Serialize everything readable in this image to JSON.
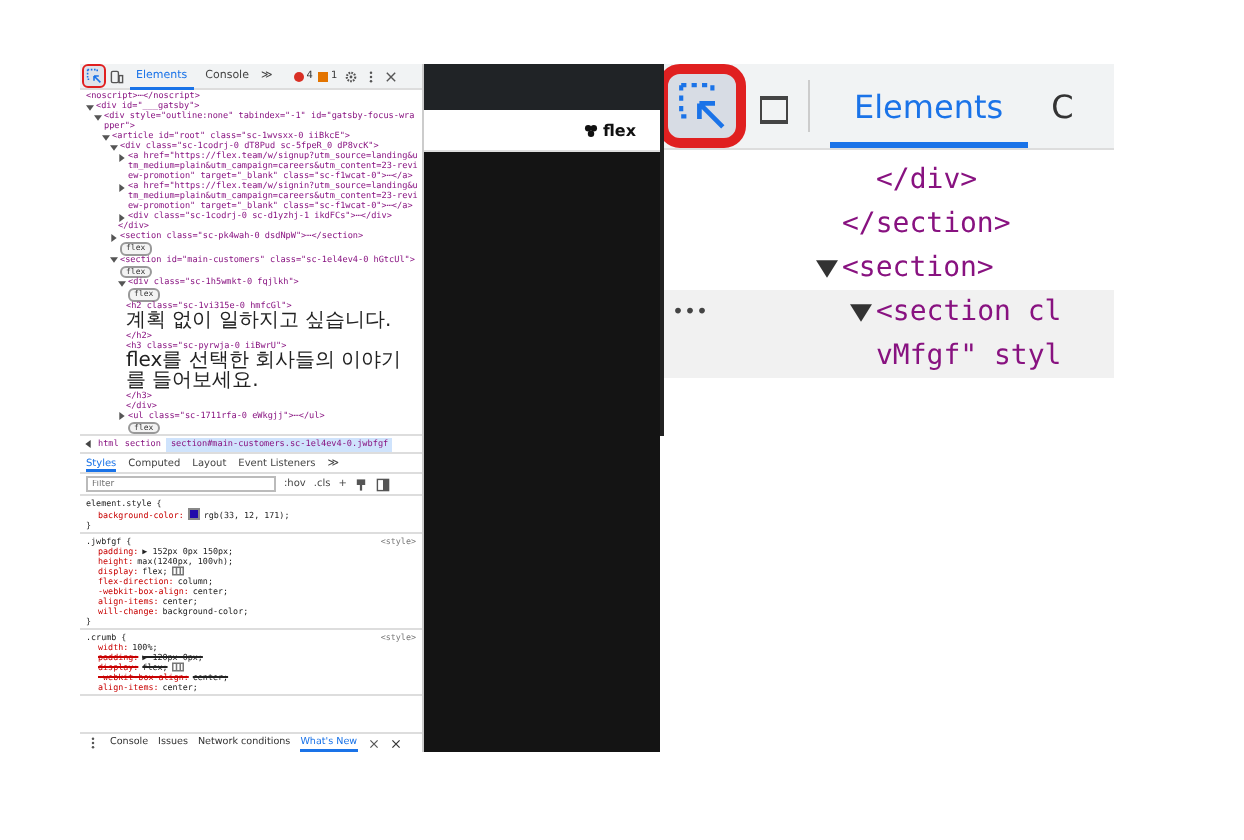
{
  "devtools": {
    "toolbar": {
      "tabs": [
        {
          "label": "Elements",
          "selected": true
        },
        {
          "label": "Console",
          "selected": false
        }
      ],
      "more": "≫",
      "error_count": "4",
      "warning_count": "1"
    },
    "dom_tree": [
      {
        "text": "<noscript>⋯</noscript>"
      },
      {
        "text": "<div id=\"___gatsby\">",
        "expanded": true,
        "children": [
          {
            "text": "<div style=\"outline:none\" tabindex=\"-1\" id=\"gatsby-focus-wrapper\">",
            "expanded": true,
            "children": [
              {
                "text": "<article id=\"root\" class=\"sc-1wvsxx-0 iiBkcE\">",
                "expanded": true,
                "children": [
                  {
                    "text": "<div class=\"sc-1codrj-0 dT8Pud sc-5fpeR_0 dP8vcK\">",
                    "expanded": true,
                    "children": [
                      {
                        "text": "<a href=\"https://flex.team/w/signup?utm_source=landing&utm_medium=plain&utm_campaign=careers&utm_content=23-review-promotion\" target=\"_blank\" class=\"sc-f1wcat-0\">⋯</a>",
                        "expanded": false
                      },
                      {
                        "text": "<a href=\"https://flex.team/w/signin?utm_source=landing&utm_medium=plain&utm_campaign=careers&utm_content=23-review-promotion\" target=\"_blank\" class=\"sc-f1wcat-0\">⋯</a>",
                        "expanded": false
                      },
                      {
                        "text": "<div class=\"sc-1codrj-0 sc-d1yzhj-1 ikdFCs\">⋯</div>",
                        "expanded": false
                      },
                      {
                        "text": "</div>"
                      }
                    ]
                  },
                  {
                    "text": "<section class=\"sc-pk4wah-0 dsdNpW\">⋯</section>",
                    "expanded": false,
                    "badge": "flex"
                  },
                  {
                    "text": "<section id=\"main-customers\" class=\"sc-1el4ev4-0 hGtcUl\">",
                    "expanded": true,
                    "badge": "flex",
                    "children": [
                      {
                        "text": "<div class=\"sc-1h5wmkt-0 fqjlkh\">",
                        "expanded": true,
                        "badge": "flex",
                        "children": [
                          {
                            "text": "<h2 class=\"sc-1vi315e-0 hmfcGl\">",
                            "korean": "계획 없이 일하지고 싶습니다.",
                            "tail": "</h2>"
                          },
                          {
                            "text": "<h3 class=\"sc-pyrwja-0 iiBwrU\">",
                            "korean": "flex를 선택한 회사들의 이야기를 들어보세요.",
                            "tail": "</h3>"
                          },
                          {
                            "text": "</div>"
                          }
                        ]
                      },
                      {
                        "text": "<ul class=\"sc-1711rfa-0 eWkgjj\">⋯</ul>",
                        "expanded": false,
                        "badge": "flex"
                      }
                    ]
                  }
                ]
              }
            ]
          }
        ]
      }
    ],
    "breadcrumbs": [
      {
        "label": "html",
        "selected": false
      },
      {
        "label": "section",
        "selected": false
      },
      {
        "label": "section#main-customers.sc-1el4ev4-0.jwbfgf",
        "selected": true
      }
    ],
    "style_tabs": [
      {
        "label": "Styles",
        "selected": true
      },
      {
        "label": "Computed",
        "selected": false
      },
      {
        "label": "Layout",
        "selected": false
      },
      {
        "label": "Event Listeners",
        "selected": false
      }
    ],
    "style_tabs_more": "≫",
    "filter": {
      "placeholder": "Filter"
    },
    "filter_buttons": [
      ":hov",
      ".cls",
      "+"
    ],
    "rules": [
      {
        "selector": "element.style {",
        "props": [
          {
            "name": "background-color:",
            "value": "rgb(33, 12, 171);",
            "kind": "swatch",
            "struck": false
          }
        ],
        "close": "}"
      },
      {
        "selector": ".jwbfgf {",
        "source": "<style>",
        "props": [
          {
            "name": "padding:",
            "value": "▶ 152px 0px 150px;",
            "struck": false
          },
          {
            "name": "height:",
            "value": "max(1240px, 100vh);",
            "struck": false
          },
          {
            "name": "display:",
            "value": "flex;",
            "kind": "grid",
            "struck": false
          },
          {
            "name": "flex-direction:",
            "value": "column;",
            "struck": false
          },
          {
            "name": "-webkit-box-align:",
            "value": "center;",
            "struck": false
          },
          {
            "name": "align-items:",
            "value": "center;",
            "struck": false
          },
          {
            "name": "will-change:",
            "value": "background-color;",
            "struck": false
          }
        ],
        "close": "}"
      },
      {
        "selector": ".crumb {",
        "source": "<style>",
        "props": [
          {
            "name": "width:",
            "value": "100%;",
            "struck": false
          },
          {
            "name": "padding:",
            "value": "▶ 120px 0px;",
            "struck": true
          },
          {
            "name": "display:",
            "value": "flex;",
            "kind": "grid",
            "struck": true
          },
          {
            "name": "-webkit-box-align:",
            "value": "center;",
            "struck": true
          },
          {
            "name": "align-items:",
            "value": "center;",
            "struck": false
          }
        ]
      }
    ],
    "drawer_tabs": [
      {
        "label": "Console",
        "selected": false
      },
      {
        "label": "Issues",
        "selected": false
      },
      {
        "label": "Network conditions",
        "selected": false
      },
      {
        "label": "What's New",
        "selected": true
      }
    ]
  },
  "page": {
    "logo": "flex"
  },
  "zoom": {
    "tabs": [
      {
        "label": "Elements",
        "selected": true
      },
      {
        "label": "C",
        "selected": false
      }
    ],
    "tree": [
      {
        "children": [
          {
            "children": [
              {
                "text": "</div>",
                "selected": false
              }
            ]
          },
          {
            "text": "</section>",
            "selected": false
          },
          {
            "text": "<section>",
            "expanded": true,
            "selected": false,
            "children": [
              {
                "text": "<section cl",
                "wrap": "vMfgf\" styl",
                "expanded": true,
                "selected": true,
                "more": "•••"
              }
            ]
          }
        ]
      }
    ]
  }
}
